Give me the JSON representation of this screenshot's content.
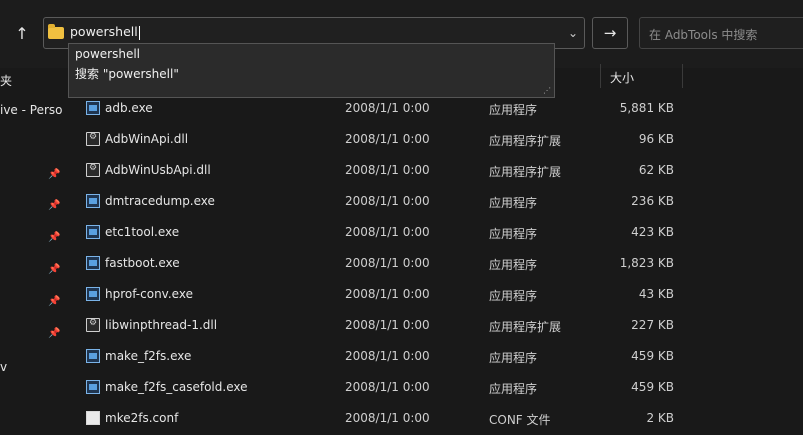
{
  "address": {
    "value": "powershell"
  },
  "search": {
    "placeholder": "在 AdbTools 中搜索"
  },
  "suggestions": [
    "powershell",
    "搜索 \"powershell\""
  ],
  "sidebar": {
    "top_label": "夹",
    "onedrive_label": "ive - Perso",
    "bottom_label": "v"
  },
  "columns": {
    "size": "大小"
  },
  "files": [
    {
      "name": "adb.exe",
      "date": "2008/1/1 0:00",
      "type": "应用程序",
      "size": "5,881 KB",
      "icon": "exe"
    },
    {
      "name": "AdbWinApi.dll",
      "date": "2008/1/1 0:00",
      "type": "应用程序扩展",
      "size": "96 KB",
      "icon": "dll"
    },
    {
      "name": "AdbWinUsbApi.dll",
      "date": "2008/1/1 0:00",
      "type": "应用程序扩展",
      "size": "62 KB",
      "icon": "dll"
    },
    {
      "name": "dmtracedump.exe",
      "date": "2008/1/1 0:00",
      "type": "应用程序",
      "size": "236 KB",
      "icon": "exe"
    },
    {
      "name": "etc1tool.exe",
      "date": "2008/1/1 0:00",
      "type": "应用程序",
      "size": "423 KB",
      "icon": "exe"
    },
    {
      "name": "fastboot.exe",
      "date": "2008/1/1 0:00",
      "type": "应用程序",
      "size": "1,823 KB",
      "icon": "exe"
    },
    {
      "name": "hprof-conv.exe",
      "date": "2008/1/1 0:00",
      "type": "应用程序",
      "size": "43 KB",
      "icon": "exe"
    },
    {
      "name": "libwinpthread-1.dll",
      "date": "2008/1/1 0:00",
      "type": "应用程序扩展",
      "size": "227 KB",
      "icon": "dll"
    },
    {
      "name": "make_f2fs.exe",
      "date": "2008/1/1 0:00",
      "type": "应用程序",
      "size": "459 KB",
      "icon": "exe"
    },
    {
      "name": "make_f2fs_casefold.exe",
      "date": "2008/1/1 0:00",
      "type": "应用程序",
      "size": "459 KB",
      "icon": "exe"
    },
    {
      "name": "mke2fs.conf",
      "date": "2008/1/1 0:00",
      "type": "CONF 文件",
      "size": "2 KB",
      "icon": "conf"
    }
  ]
}
